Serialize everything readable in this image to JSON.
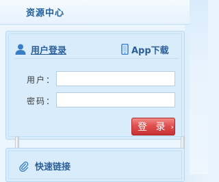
{
  "header": {
    "title": "资源中心",
    "icon": "none"
  },
  "login": {
    "tab_user": {
      "label": "用户登录",
      "icon": "user-icon",
      "underlined": true
    },
    "tab_app": {
      "label": "App下载",
      "icon": "phone-icon"
    },
    "username_label": "用户：",
    "password_label": "密码：",
    "username_value": "",
    "password_value": "",
    "submit_label": "登 录",
    "submit_arrow": "›"
  },
  "quick_links": {
    "title": "快速链接",
    "icon": "paperclip-icon"
  },
  "colors": {
    "accent_text": "#2c5f96",
    "card_bg": "#d8ecfb",
    "button_red": "#e0504f"
  }
}
